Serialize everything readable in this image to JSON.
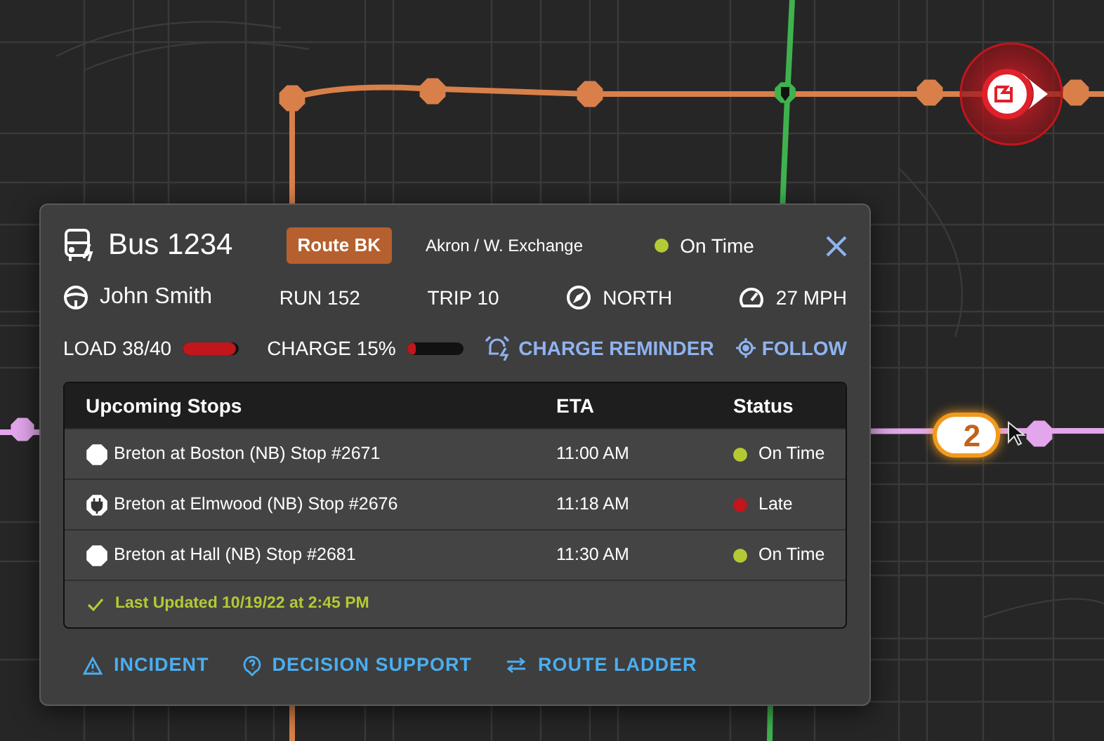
{
  "map": {
    "vehicle_marker": {
      "label": "2"
    }
  },
  "panel": {
    "vehicle": "Bus 1234",
    "route_badge": "Route BK",
    "destination": "Akron / W. Exchange",
    "status": {
      "label": "On Time",
      "color": "#b5c935"
    },
    "driver": "John Smith",
    "run": "RUN 152",
    "trip": "TRIP 10",
    "heading": "NORTH",
    "speed": "27 MPH",
    "load": {
      "label": "LOAD 38/40",
      "level": 0.95
    },
    "charge": {
      "label": "CHARGE 15%",
      "level": 0.15
    },
    "actions": [
      {
        "label": "CHARGE REMINDER",
        "kind": "reminder"
      },
      {
        "label": "FOLLOW",
        "kind": "follow"
      }
    ],
    "stops": {
      "columns": [
        "Upcoming Stops",
        "ETA",
        "Status"
      ],
      "rows": [
        {
          "name": "Breton at Boston (NB) Stop #2671",
          "kind": "stop",
          "eta": "11:00 AM",
          "status": "On Time",
          "color": "#b5c935"
        },
        {
          "name": "Breton at Elmwood (NB) Stop #2676",
          "kind": "charger",
          "eta": "11:18 AM",
          "status": "Late",
          "color": "#c0161c"
        },
        {
          "name": "Breton at Hall (NB) Stop #2681",
          "kind": "stop",
          "eta": "11:30 AM",
          "status": "On Time",
          "color": "#b5c935"
        }
      ],
      "last_updated": "Last Updated 10/19/22 at 2:45 PM"
    },
    "footer_actions": [
      {
        "label": "INCIDENT",
        "kind": "incident"
      },
      {
        "label": "DECISION SUPPORT",
        "kind": "support"
      },
      {
        "label": "ROUTE LADDER",
        "kind": "ladder"
      }
    ]
  }
}
